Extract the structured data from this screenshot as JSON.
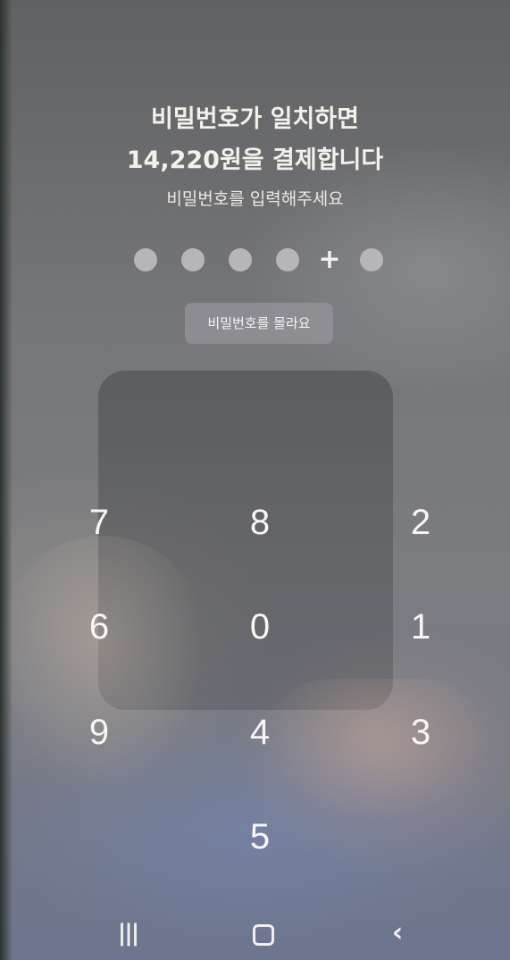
{
  "payment": {
    "title_line1": "비밀번호가 일치하면",
    "title_line2": "14,220원을 결제합니다",
    "subtitle": "비밀번호를 입력해주세요",
    "pin_indicators": [
      "●",
      "●",
      "●",
      "●",
      "+",
      "●"
    ],
    "forgot_button": "비밀번호를 몰라요"
  },
  "keypad": {
    "keys": [
      "7",
      "8",
      "2",
      "6",
      "0",
      "1",
      "9",
      "4",
      "3",
      "5"
    ]
  },
  "navbar": {
    "recents_glyph": "|||",
    "back_glyph": "‹",
    "icons": [
      "recents-icon",
      "home-icon",
      "back-icon"
    ]
  }
}
